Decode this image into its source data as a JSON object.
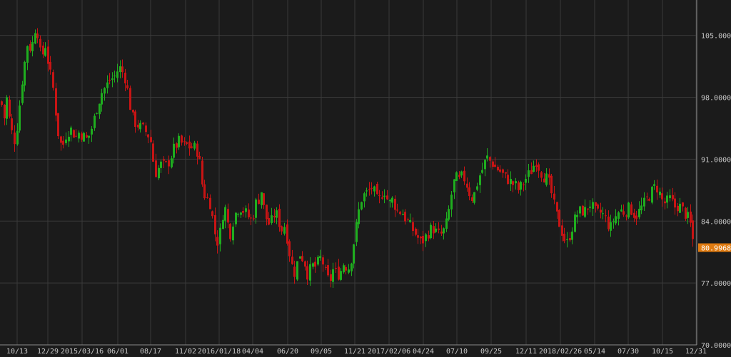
{
  "colors": {
    "background": "#1b1b1b",
    "grid": "#3a3a3a",
    "axis_text": "#c8c8c8",
    "up_candle": "#1fae1f",
    "down_candle": "#c81414",
    "last_price_badge": "#e07b10",
    "last_price_text": "#ffffff"
  },
  "chart_data": {
    "type": "candlestick",
    "ylim": [
      70,
      109
    ],
    "y_ticks": [
      "105.0000",
      "98.0000",
      "91.0000",
      "84.0000",
      "77.0000",
      "70.0000"
    ],
    "y_tick_values": [
      105,
      98,
      91,
      84,
      77,
      70
    ],
    "x_tick_labels": [
      "10/13",
      "12/29",
      "2015/03/16",
      "06/01",
      "08/17",
      "11/02",
      "2016/01/18",
      "04/04",
      "06/20",
      "09/05",
      "11/21",
      "2017/02/06",
      "04/24",
      "07/10",
      "09/25",
      "12/11",
      "2018/02/26",
      "05/14",
      "07/30",
      "10/15",
      "12/31"
    ],
    "last_price": "80.9968",
    "last_price_value": 80.9968,
    "grid": true,
    "close_path": [
      [
        0,
        97.5
      ],
      [
        3,
        97
      ],
      [
        6,
        95.5
      ],
      [
        9,
        98
      ],
      [
        12,
        96
      ],
      [
        15,
        94.5
      ],
      [
        18,
        93.5
      ],
      [
        21,
        93
      ],
      [
        24,
        95
      ],
      [
        27,
        97
      ],
      [
        30,
        99.5
      ],
      [
        33,
        101
      ],
      [
        36,
        103
      ],
      [
        39,
        104.5
      ],
      [
        42,
        103.5
      ],
      [
        45,
        104
      ],
      [
        48,
        105.5
      ],
      [
        51,
        106.5
      ],
      [
        54,
        104
      ],
      [
        57,
        102.5
      ],
      [
        60,
        103
      ],
      [
        63,
        104
      ],
      [
        66,
        102.5
      ],
      [
        69,
        101
      ],
      [
        72,
        100
      ],
      [
        75,
        98.5
      ],
      [
        78,
        96
      ],
      [
        81,
        94
      ],
      [
        84,
        93
      ],
      [
        87,
        92
      ],
      [
        90,
        93.5
      ],
      [
        94,
        94
      ],
      [
        98,
        94.5
      ],
      [
        102,
        94
      ],
      [
        106,
        93.5
      ],
      [
        110,
        94
      ],
      [
        114,
        93.8
      ],
      [
        118,
        93.5
      ],
      [
        122,
        93.2
      ],
      [
        126,
        94
      ],
      [
        130,
        95
      ],
      [
        134,
        96.5
      ],
      [
        138,
        97.5
      ],
      [
        142,
        98.5
      ],
      [
        146,
        99
      ],
      [
        150,
        99.5
      ],
      [
        154,
        100
      ],
      [
        158,
        100.2
      ],
      [
        162,
        100.5
      ],
      [
        166,
        101.5
      ],
      [
        170,
        101
      ],
      [
        174,
        100.5
      ],
      [
        178,
        99
      ],
      [
        182,
        97
      ],
      [
        186,
        95.5
      ],
      [
        190,
        95
      ],
      [
        194,
        94.8
      ],
      [
        198,
        94.5
      ],
      [
        202,
        94.3
      ],
      [
        206,
        93.8
      ],
      [
        210,
        93.5
      ],
      [
        214,
        91
      ],
      [
        218,
        89.5
      ],
      [
        222,
        90
      ],
      [
        226,
        90.5
      ],
      [
        230,
        90.2
      ],
      [
        234,
        90.4
      ],
      [
        238,
        91
      ],
      [
        242,
        92
      ],
      [
        246,
        92.5
      ],
      [
        250,
        93
      ],
      [
        254,
        92.8
      ],
      [
        258,
        92.5
      ],
      [
        262,
        92.6
      ],
      [
        266,
        92.3
      ],
      [
        270,
        92.4
      ],
      [
        274,
        92.2
      ],
      [
        278,
        91.5
      ],
      [
        282,
        88.5
      ],
      [
        286,
        87
      ],
      [
        290,
        86.5
      ],
      [
        294,
        86
      ],
      [
        298,
        84
      ],
      [
        302,
        82
      ],
      [
        306,
        81.5
      ],
      [
        310,
        84
      ],
      [
        314,
        86
      ],
      [
        318,
        84
      ],
      [
        322,
        82.5
      ],
      [
        326,
        84
      ],
      [
        330,
        85
      ],
      [
        334,
        85.5
      ],
      [
        338,
        85.5
      ],
      [
        342,
        85
      ],
      [
        346,
        84.8
      ],
      [
        350,
        84
      ],
      [
        354,
        84.5
      ],
      [
        358,
        86
      ],
      [
        362,
        86.5
      ],
      [
        366,
        87.5
      ],
      [
        370,
        85
      ],
      [
        374,
        84
      ],
      [
        378,
        83.5
      ],
      [
        382,
        84.5
      ],
      [
        386,
        85
      ],
      [
        390,
        84
      ],
      [
        394,
        83
      ],
      [
        398,
        83.5
      ],
      [
        402,
        82
      ],
      [
        406,
        80
      ],
      [
        410,
        78.5
      ],
      [
        414,
        78
      ],
      [
        418,
        80.5
      ],
      [
        422,
        80
      ],
      [
        426,
        79.5
      ],
      [
        430,
        78
      ],
      [
        434,
        78.5
      ],
      [
        438,
        79
      ],
      [
        442,
        78.8
      ],
      [
        446,
        79.5
      ],
      [
        450,
        80
      ],
      [
        454,
        78.5
      ],
      [
        458,
        77.5
      ],
      [
        462,
        77.2
      ],
      [
        466,
        78.5
      ],
      [
        470,
        78.2
      ],
      [
        474,
        78
      ],
      [
        478,
        78.5
      ],
      [
        482,
        79.5
      ],
      [
        486,
        78.5
      ],
      [
        490,
        79
      ],
      [
        494,
        81
      ],
      [
        498,
        83
      ],
      [
        502,
        85
      ],
      [
        506,
        86.5
      ],
      [
        510,
        87
      ],
      [
        514,
        87.2
      ],
      [
        518,
        87.5
      ],
      [
        522,
        88
      ],
      [
        526,
        86.5
      ],
      [
        530,
        86.2
      ],
      [
        534,
        87
      ],
      [
        538,
        87.5
      ],
      [
        542,
        86.5
      ],
      [
        546,
        86
      ],
      [
        550,
        86.5
      ],
      [
        554,
        85.5
      ],
      [
        558,
        85
      ],
      [
        562,
        85.2
      ],
      [
        566,
        84.5
      ],
      [
        570,
        84
      ],
      [
        574,
        83.5
      ],
      [
        578,
        83
      ],
      [
        582,
        82.5
      ],
      [
        586,
        82
      ],
      [
        590,
        81.5
      ],
      [
        594,
        82
      ],
      [
        598,
        82.5
      ],
      [
        602,
        83
      ],
      [
        606,
        83.2
      ],
      [
        610,
        82.8
      ],
      [
        614,
        82.5
      ],
      [
        618,
        82.5
      ],
      [
        622,
        83
      ],
      [
        626,
        84
      ],
      [
        630,
        86
      ],
      [
        634,
        88
      ],
      [
        638,
        89
      ],
      [
        642,
        88.5
      ],
      [
        646,
        89
      ],
      [
        650,
        88.8
      ],
      [
        654,
        88
      ],
      [
        658,
        87
      ],
      [
        662,
        86.5
      ],
      [
        666,
        87.5
      ],
      [
        670,
        89
      ],
      [
        674,
        89.5
      ],
      [
        678,
        90.5
      ],
      [
        682,
        91.2
      ],
      [
        686,
        90.8
      ],
      [
        690,
        90.5
      ],
      [
        694,
        90
      ],
      [
        698,
        89.8
      ],
      [
        702,
        89.5
      ],
      [
        706,
        89
      ],
      [
        710,
        88.8
      ],
      [
        714,
        88.5
      ],
      [
        718,
        88.2
      ],
      [
        722,
        88
      ],
      [
        726,
        87.5
      ],
      [
        730,
        88
      ],
      [
        734,
        88.5
      ],
      [
        738,
        89
      ],
      [
        742,
        89.5
      ],
      [
        746,
        90
      ],
      [
        750,
        91
      ],
      [
        754,
        90.2
      ],
      [
        758,
        89.5
      ],
      [
        762,
        89
      ],
      [
        766,
        88.8
      ],
      [
        770,
        88
      ],
      [
        774,
        86.5
      ],
      [
        778,
        85
      ],
      [
        782,
        84
      ],
      [
        786,
        83
      ],
      [
        790,
        82
      ],
      [
        794,
        81.5
      ],
      [
        798,
        82.5
      ],
      [
        802,
        83.5
      ],
      [
        806,
        84.5
      ],
      [
        810,
        85
      ],
      [
        814,
        85.2
      ],
      [
        818,
        85
      ],
      [
        822,
        85.5
      ],
      [
        826,
        86
      ],
      [
        830,
        85.5
      ],
      [
        834,
        85
      ],
      [
        838,
        84.8
      ],
      [
        842,
        85
      ],
      [
        846,
        84.5
      ],
      [
        850,
        84
      ],
      [
        854,
        83
      ],
      [
        858,
        84
      ],
      [
        862,
        84.5
      ],
      [
        866,
        85
      ],
      [
        870,
        85.2
      ],
      [
        874,
        85
      ],
      [
        878,
        85.3
      ],
      [
        882,
        85.5
      ],
      [
        886,
        85
      ],
      [
        890,
        84.5
      ],
      [
        894,
        85
      ],
      [
        898,
        85.5
      ],
      [
        902,
        86
      ],
      [
        906,
        86.5
      ],
      [
        910,
        87
      ],
      [
        914,
        87.5
      ],
      [
        918,
        88
      ],
      [
        922,
        87.5
      ],
      [
        926,
        86.5
      ],
      [
        930,
        86
      ],
      [
        934,
        86.2
      ],
      [
        938,
        86.5
      ],
      [
        942,
        86
      ],
      [
        946,
        85.5
      ],
      [
        950,
        85.8
      ],
      [
        954,
        85.5
      ],
      [
        958,
        85
      ],
      [
        962,
        84.5
      ],
      [
        966,
        84
      ],
      [
        970,
        82
      ],
      [
        974,
        81
      ]
    ]
  }
}
